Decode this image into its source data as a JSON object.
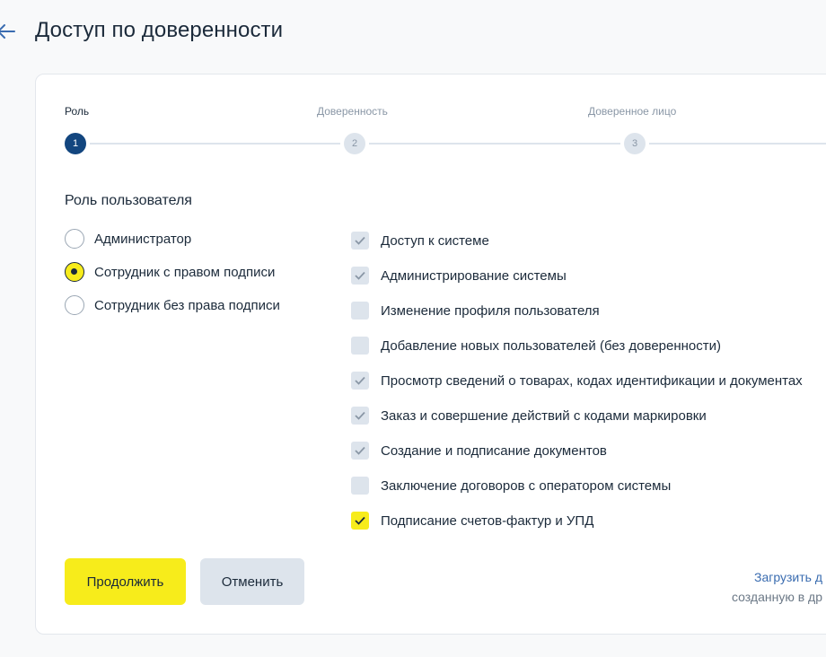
{
  "header": {
    "title": "Доступ по доверенности",
    "back_icon": "arrow-left-icon"
  },
  "stepper": {
    "steps": [
      {
        "label": "Роль",
        "number": "1",
        "active": true
      },
      {
        "label": "Доверенность",
        "number": "2",
        "active": false
      },
      {
        "label": "Доверенное лицо",
        "number": "3",
        "active": false
      }
    ]
  },
  "role": {
    "title": "Роль пользователя",
    "options": [
      {
        "label": "Администратор",
        "selected": false
      },
      {
        "label": "Сотрудник с правом подписи",
        "selected": true
      },
      {
        "label": "Сотрудник без права подписи",
        "selected": false
      }
    ]
  },
  "permissions": [
    {
      "label": "Доступ к системе",
      "state": "checked-disabled"
    },
    {
      "label": "Администрирование системы",
      "state": "checked-disabled"
    },
    {
      "label": "Изменение профиля пользователя",
      "state": "unchecked-disabled"
    },
    {
      "label": "Добавление новых пользователей (без доверенности)",
      "state": "unchecked-disabled"
    },
    {
      "label": "Просмотр сведений о товарах, кодах идентификации и документах",
      "state": "checked-disabled"
    },
    {
      "label": "Заказ и совершение действий с кодами маркировки",
      "state": "checked-disabled"
    },
    {
      "label": "Создание и подписание документов",
      "state": "checked-disabled"
    },
    {
      "label": "Заключение договоров с оператором системы",
      "state": "unchecked-disabled"
    },
    {
      "label": "Подписание счетов-фактур и УПД",
      "state": "checked"
    }
  ],
  "actions": {
    "continue_label": "Продолжить",
    "cancel_label": "Отменить"
  },
  "upload": {
    "link_text": "Загрузить д",
    "sub_text": "созданную в др"
  },
  "colors": {
    "accent_yellow": "#f7ec1b",
    "step_active": "#13467f",
    "link": "#3a6cb0"
  }
}
